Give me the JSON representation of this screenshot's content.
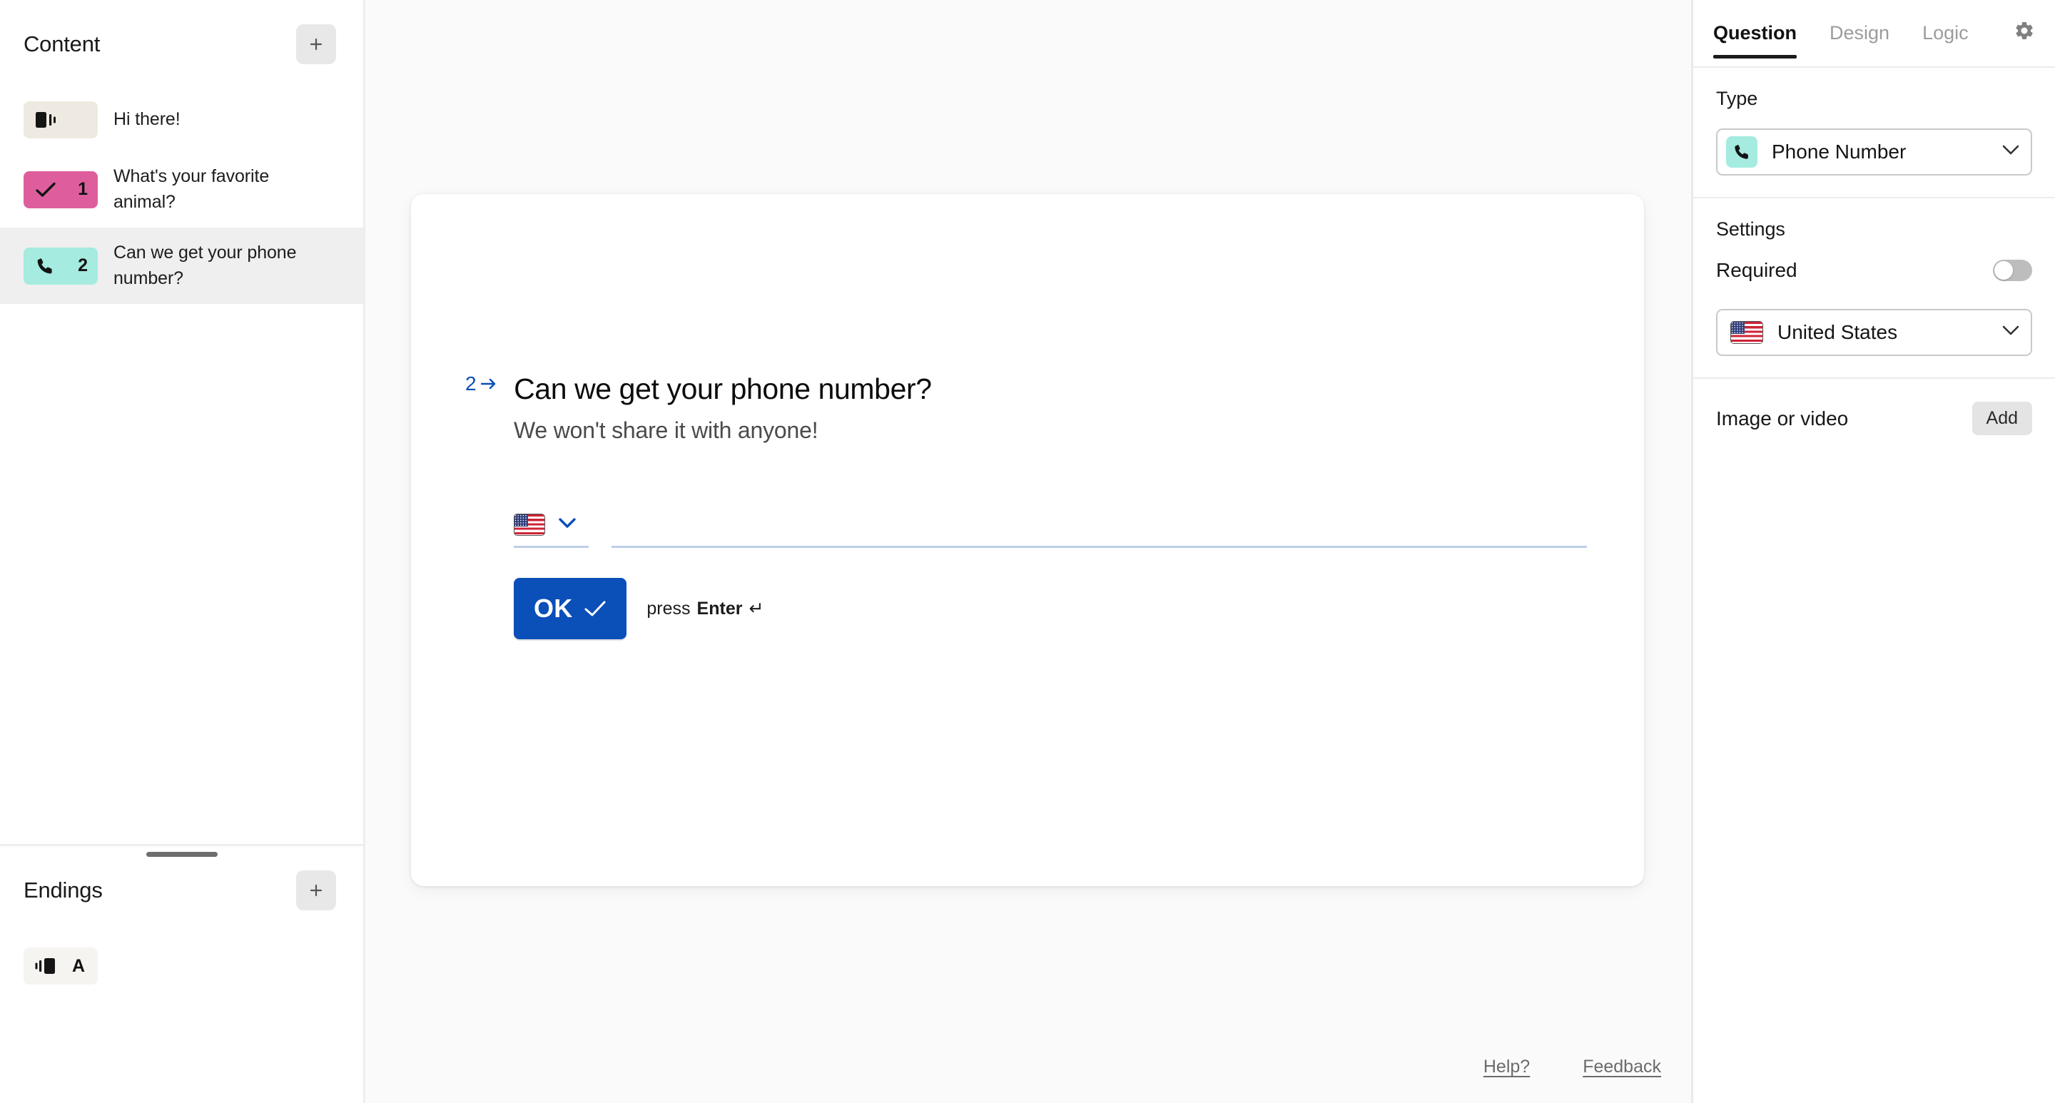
{
  "sidebar": {
    "content": {
      "title": "Content",
      "add_label": "+",
      "items": [
        {
          "kind": "welcome",
          "icon": "welcome-screen-icon",
          "badge": "",
          "label": "Hi there!",
          "chip_color": "#efeae1",
          "selected": false
        },
        {
          "kind": "multiple-choice",
          "icon": "check-icon",
          "badge": "1",
          "label": "What's your favorite animal?",
          "chip_color": "#de5e9d",
          "selected": false
        },
        {
          "kind": "phone",
          "icon": "phone-icon",
          "badge": "2",
          "label": "Can we get your phone number?",
          "chip_color": "#a5ebdf",
          "selected": true
        }
      ]
    },
    "endings": {
      "title": "Endings",
      "add_label": "+",
      "items": [
        {
          "kind": "ending",
          "icon": "ending-screen-icon",
          "badge": "A",
          "label": "",
          "chip_color": "#f5f4f0",
          "selected": false
        }
      ]
    }
  },
  "canvas": {
    "question": {
      "index": "2",
      "arrow": "arrow-right-icon",
      "title": "Can we get your phone number?",
      "description": "We won't share it with anyone!"
    },
    "phone_field": {
      "country_flag": "us-flag-icon",
      "country_code_value": "",
      "value": "",
      "placeholder": ""
    },
    "submit": {
      "label": "OK",
      "check_icon": "check-icon",
      "hint_prefix": "press",
      "hint_key": "Enter",
      "hint_symbol": "↵"
    },
    "footer": {
      "help": "Help?",
      "feedback": "Feedback"
    }
  },
  "right_panel": {
    "tabs": [
      {
        "label": "Question",
        "active": true
      },
      {
        "label": "Design",
        "active": false
      },
      {
        "label": "Logic",
        "active": false
      }
    ],
    "settings_icon": "gear-icon",
    "type": {
      "section_title": "Type",
      "icon": "phone-icon",
      "value": "Phone Number",
      "chevron": "chevron-down-icon"
    },
    "settings": {
      "section_title": "Settings",
      "required_label": "Required",
      "required_value": "off",
      "country": {
        "flag": "us-flag-icon",
        "value": "United States",
        "chevron": "chevron-down-icon"
      }
    },
    "media": {
      "label": "Image or video",
      "add_label": "Add"
    }
  },
  "colors": {
    "accent_blue": "#0b4fb8",
    "pink": "#de5e9d",
    "mint": "#a5ebdf",
    "cream": "#efeae1",
    "canvas_bg": "#fafafa",
    "selected_row": "#efefef"
  }
}
